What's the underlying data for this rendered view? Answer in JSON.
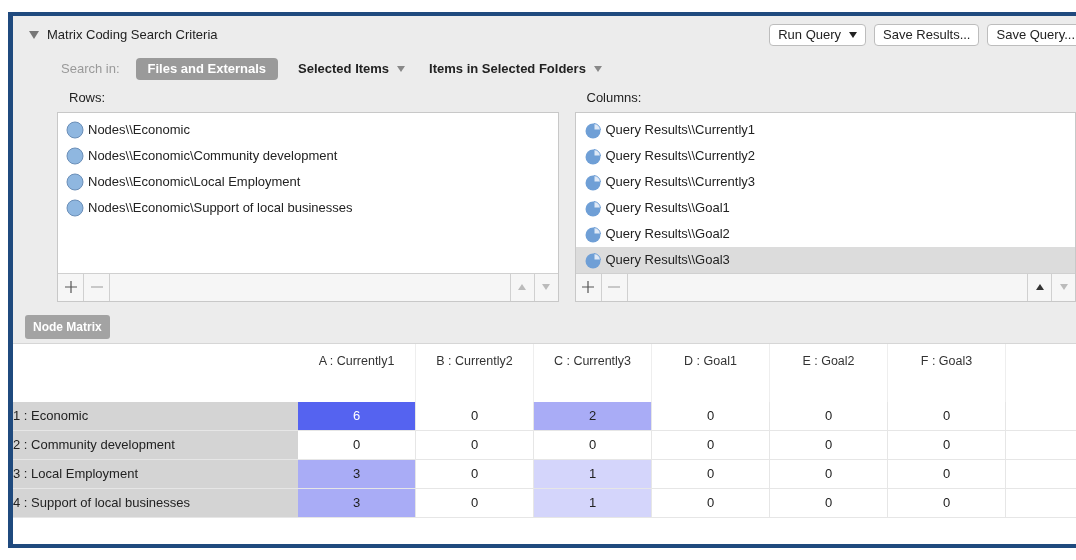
{
  "panel": {
    "title": "Matrix Coding Search Criteria",
    "expanded": true,
    "buttons": [
      {
        "label": "Run Query",
        "dropdown": true
      },
      {
        "label": "Save Results...",
        "dropdown": false
      },
      {
        "label": "Save Query...",
        "dropdown": false
      }
    ],
    "search_in": {
      "label": "Search in:",
      "options": [
        {
          "label": "Files and Externals",
          "selected": true,
          "dropdown": false
        },
        {
          "label": "Selected Items",
          "selected": false,
          "dropdown": true
        },
        {
          "label": "Items in Selected Folders",
          "selected": false,
          "dropdown": true
        }
      ]
    },
    "rows": {
      "label": "Rows:",
      "items": [
        {
          "text": "Nodes\\\\Economic",
          "selected": false
        },
        {
          "text": "Nodes\\\\Economic\\Community development",
          "selected": false
        },
        {
          "text": "Nodes\\\\Economic\\Local Employment",
          "selected": false
        },
        {
          "text": "Nodes\\\\Economic\\Support of local businesses",
          "selected": false
        }
      ]
    },
    "columns": {
      "label": "Columns:",
      "items": [
        {
          "text": "Query Results\\\\Currently1",
          "selected": false
        },
        {
          "text": "Query Results\\\\Currently2",
          "selected": false
        },
        {
          "text": "Query Results\\\\Currently3",
          "selected": false
        },
        {
          "text": "Query Results\\\\Goal1",
          "selected": false
        },
        {
          "text": "Query Results\\\\Goal2",
          "selected": false
        },
        {
          "text": "Query Results\\\\Goal3",
          "selected": true
        }
      ]
    }
  },
  "matrix": {
    "tab": "Node Matrix",
    "columns": [
      "A : Currently1",
      "B : Currently2",
      "C : Currently3",
      "D : Goal1",
      "E : Goal2",
      "F : Goal3"
    ],
    "rows": [
      {
        "label": "1 : Economic",
        "cells": [
          {
            "value": "6",
            "color": "#5563f0"
          },
          {
            "value": "0",
            "color": "#ffffff"
          },
          {
            "value": "2",
            "color": "#a9acf6"
          },
          {
            "value": "0",
            "color": "#ffffff"
          },
          {
            "value": "0",
            "color": "#ffffff"
          },
          {
            "value": "0",
            "color": "#ffffff"
          }
        ]
      },
      {
        "label": "2 : Community development",
        "cells": [
          {
            "value": "0",
            "color": "#ffffff"
          },
          {
            "value": "0",
            "color": "#ffffff"
          },
          {
            "value": "0",
            "color": "#ffffff"
          },
          {
            "value": "0",
            "color": "#ffffff"
          },
          {
            "value": "0",
            "color": "#ffffff"
          },
          {
            "value": "0",
            "color": "#ffffff"
          }
        ]
      },
      {
        "label": "3 : Local Employment",
        "cells": [
          {
            "value": "3",
            "color": "#a9acf6"
          },
          {
            "value": "0",
            "color": "#ffffff"
          },
          {
            "value": "1",
            "color": "#d4d5fb"
          },
          {
            "value": "0",
            "color": "#ffffff"
          },
          {
            "value": "0",
            "color": "#ffffff"
          },
          {
            "value": "0",
            "color": "#ffffff"
          }
        ]
      },
      {
        "label": "4 : Support of local businesses",
        "cells": [
          {
            "value": "3",
            "color": "#a9acf6"
          },
          {
            "value": "0",
            "color": "#ffffff"
          },
          {
            "value": "1",
            "color": "#d4d5fb"
          },
          {
            "value": "0",
            "color": "#ffffff"
          },
          {
            "value": "0",
            "color": "#ffffff"
          },
          {
            "value": "0",
            "color": "#ffffff"
          }
        ]
      }
    ]
  }
}
